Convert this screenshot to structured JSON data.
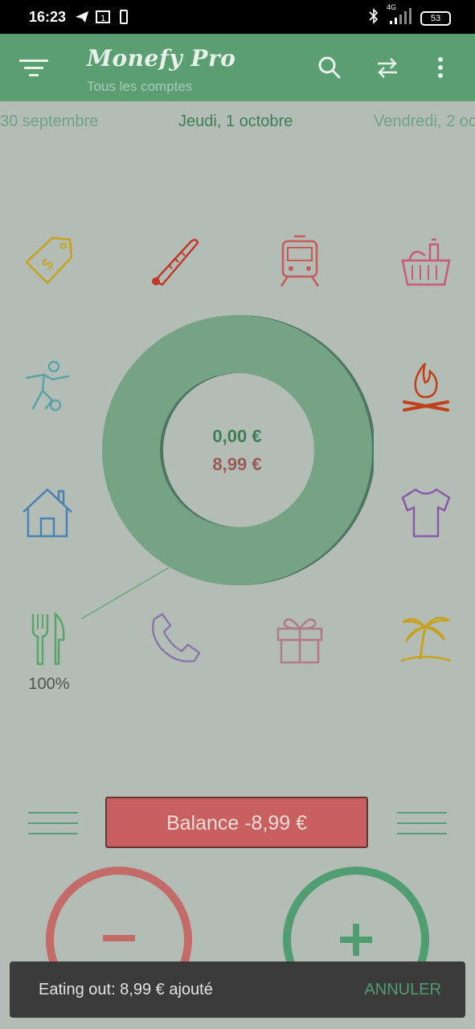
{
  "status_bar": {
    "time": "16:23",
    "network": "4G",
    "battery": "53"
  },
  "app_bar": {
    "title": "Monefy Pro",
    "subtitle": "Tous les comptes"
  },
  "dates": {
    "previous": "30 septembre",
    "current": "Jeudi, 1 octobre",
    "next": "Vendredi, 2 oc"
  },
  "categories": [
    {
      "icon": "price-tag-icon",
      "color": "#c8a21b"
    },
    {
      "icon": "thermometer-icon",
      "color": "#c0392b"
    },
    {
      "icon": "train-icon",
      "color": "#c85a5a"
    },
    {
      "icon": "grocery-basket-icon",
      "color": "#c85a7a"
    },
    {
      "icon": "football-player-icon",
      "color": "#5aa3a8"
    },
    {
      "icon": "campfire-icon",
      "color": "#c0401a"
    },
    {
      "icon": "house-icon",
      "color": "#4a82b0"
    },
    {
      "icon": "tshirt-icon",
      "color": "#8a5aa8"
    },
    {
      "icon": "fork-knife-icon",
      "color": "#5aa36a"
    },
    {
      "icon": "phone-icon",
      "color": "#8a78a8"
    },
    {
      "icon": "gift-icon",
      "color": "#b07a88"
    },
    {
      "icon": "palm-tree-icon",
      "color": "#c8a21b"
    }
  ],
  "chart_center": {
    "income": "0,00 €",
    "expense": "8,99 €"
  },
  "eating_out_percent": "100%",
  "balance_label": "Balance -8,99 €",
  "snackbar": {
    "message": "Eating out: 8,99 € ajouté",
    "action": "ANNULER"
  },
  "colors": {
    "accent_green": "#5a9e72",
    "expense_red": "#c86060"
  }
}
